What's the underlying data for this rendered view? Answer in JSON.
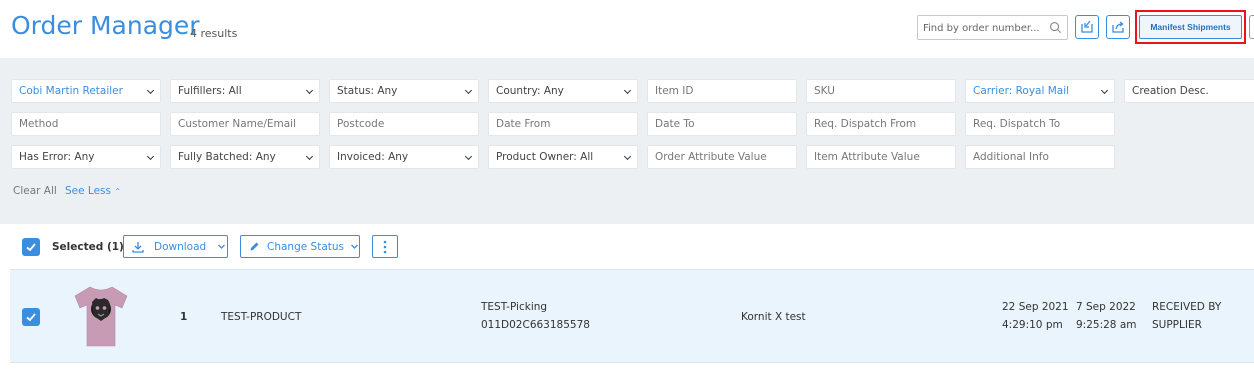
{
  "header": {
    "title": "Order Manager",
    "results": "4 results",
    "search_placeholder": "Find by order number...",
    "manifest_label": "Manifest Shipments"
  },
  "filters": {
    "row1": [
      "Cobi Martin Retailer",
      "Fulfillers: All",
      "Status: Any",
      "Country: Any",
      "Item ID",
      "SKU",
      "Carrier: Royal Mail",
      "Creation Desc."
    ],
    "row2": [
      "Method",
      "Customer Name/Email",
      "Postcode",
      "Date From",
      "Date To",
      "Req. Dispatch From",
      "Req. Dispatch To"
    ],
    "row3": [
      "Has Error: Any",
      "Fully Batched: Any",
      "Invoiced: Any",
      "Product Owner: All",
      "Order Attribute Value",
      "Item Attribute Value",
      "Additional Info"
    ],
    "clear_all": "Clear All",
    "see_less": "See Less"
  },
  "toolbar": {
    "selected": "Selected (1)",
    "download": "Download",
    "change_status": "Change Status"
  },
  "order_row": {
    "quantity": "1",
    "product": "TEST-PRODUCT",
    "picking": "TEST-Picking",
    "order_number": "011D02C663185578",
    "fulfiller": "Kornit X test",
    "created_date": "22 Sep 2021",
    "created_time": "4:29:10 pm",
    "dispatch_date": "7 Sep 2022",
    "dispatch_time": "9:25:28 am",
    "status_line1": "RECEIVED BY",
    "status_line2": "SUPPLIER"
  },
  "colors": {
    "accent": "#3a8ee0",
    "highlight": "#e8131b",
    "filter_bg": "#edf0f3",
    "row_bg": "#eaf4fd",
    "shirt": "#c79bb4"
  }
}
